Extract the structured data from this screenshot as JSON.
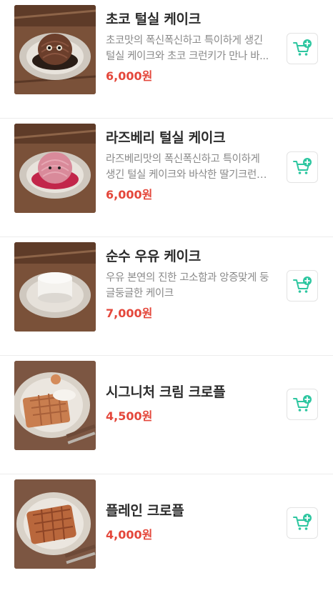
{
  "menu": {
    "items": [
      {
        "name": "초코 털실 케이크",
        "desc": "초코맛의 폭신폭신하고 특이하게 생긴 털실 케이크와 초코 크런키가 만나 바...",
        "price": "6,000원"
      },
      {
        "name": "라즈베리 털실 케이크",
        "desc": "라즈베리맛의 폭신폭신하고 특이하게 생긴 털실 케이크와 바삭한 딸기크런키가 ...",
        "price": "6,000원"
      },
      {
        "name": "순수 우유 케이크",
        "desc": "우유 본연의 진한 고소함과 앙증맞게 둥글둥글한 케이크",
        "price": "7,000원"
      },
      {
        "name": "시그니처 크림 크로플",
        "desc": "",
        "price": "4,500원"
      },
      {
        "name": "플레인 크로플",
        "desc": "",
        "price": "4,000원"
      }
    ]
  },
  "colors": {
    "price": "#e4473b",
    "cart_icon": "#2dc6a0",
    "name": "#2b2b2b",
    "desc": "#8a8a8a"
  },
  "icons": {
    "cart": "cart-add-icon"
  }
}
